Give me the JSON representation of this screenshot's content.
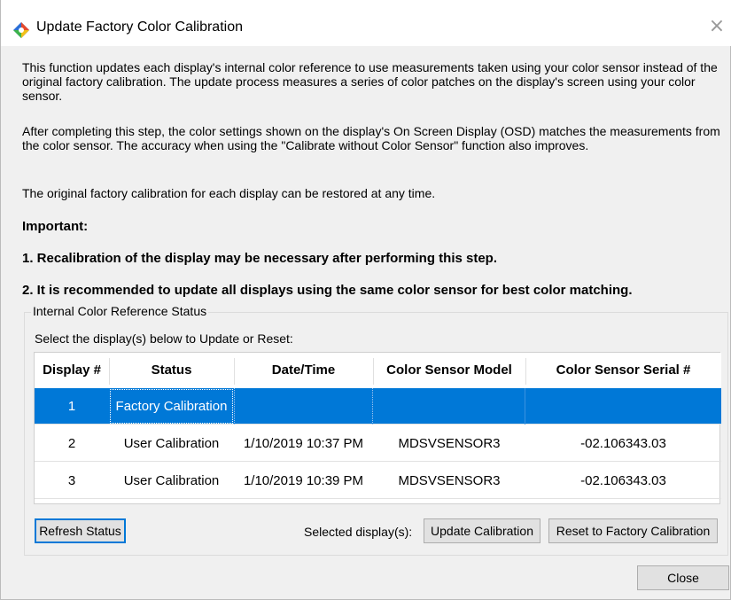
{
  "window": {
    "title": "Update Factory Color Calibration",
    "close_glyph": "×",
    "icon": "color-calibration-app-icon"
  },
  "description": {
    "para1": "This function updates each display's internal color reference to use measurements taken using your color sensor instead of the original factory calibration. The update process measures a series of color patches on the display's screen using your color sensor.",
    "para2": "After completing this step, the color settings shown on the display's On Screen Display (OSD) matches the measurements from the color sensor. The accuracy when using the \"Calibrate without Color Sensor\" function also improves.",
    "para3": "The original factory calibration for each display can be restored at any time.",
    "important": "Important:",
    "note1": "1. Recalibration of the display may be necessary after performing this step.",
    "note2": "2. It is recommended to update all displays using the same color sensor for best color matching."
  },
  "group": {
    "legend": "Internal Color Reference Status",
    "select_label": "Select the display(s) below to Update or Reset:"
  },
  "table": {
    "headers": [
      "Display #",
      "Status",
      "Date/Time",
      "Color Sensor Model",
      "Color Sensor Serial #"
    ],
    "rows": [
      {
        "display": "1",
        "status": "Factory Calibration",
        "datetime": "",
        "model": "",
        "serial": "",
        "selected": true
      },
      {
        "display": "2",
        "status": "User Calibration",
        "datetime": "1/10/2019 10:37 PM",
        "model": "MDSVSENSOR3",
        "serial": "-02.106343.03",
        "selected": false
      },
      {
        "display": "3",
        "status": "User Calibration",
        "datetime": "1/10/2019 10:39 PM",
        "model": "MDSVSENSOR3",
        "serial": "-02.106343.03",
        "selected": false
      }
    ]
  },
  "buttons": {
    "refresh": "Refresh Status",
    "selected_label": "Selected display(s):",
    "update": "Update Calibration",
    "reset": "Reset to Factory Calibration",
    "close": "Close"
  },
  "colors": {
    "selection": "#0078d7",
    "dialog_bg": "#f0f0f0"
  }
}
